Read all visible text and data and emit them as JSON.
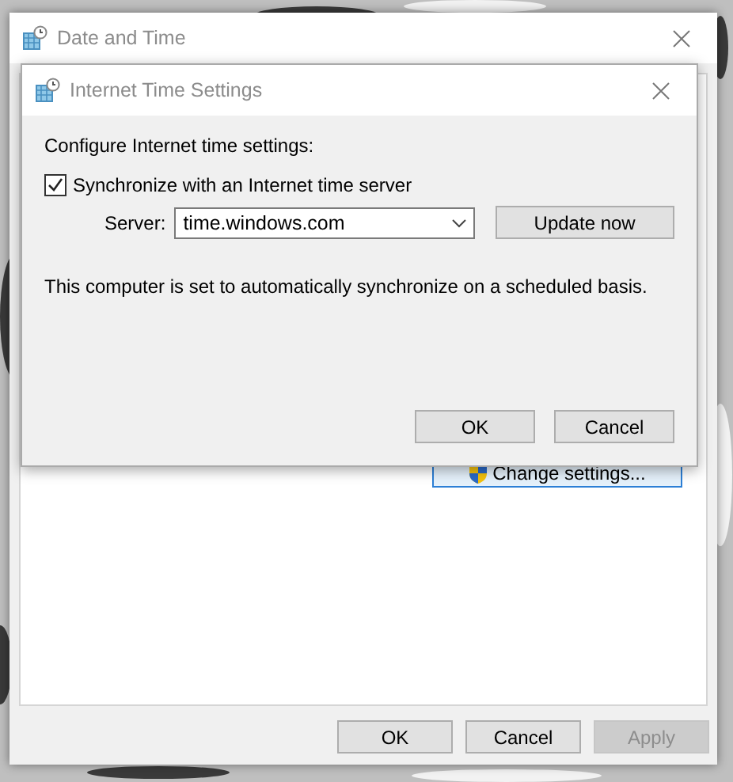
{
  "main_window": {
    "title": "Date and Time",
    "change_settings": "Change settings...",
    "buttons": [
      {
        "label": "OK",
        "disabled": false
      },
      {
        "label": "Cancel",
        "disabled": false
      },
      {
        "label": "Apply",
        "disabled": true
      }
    ]
  },
  "dialog": {
    "title": "Internet Time Settings",
    "heading": "Configure Internet time settings:",
    "sync": {
      "label": "Synchronize with an Internet time server",
      "checked": true
    },
    "server_label": "Server:",
    "server_value": "time.windows.com",
    "update_button": "Update now",
    "status": "This computer is set to automatically synchronize on a scheduled basis.",
    "buttons": [
      "OK",
      "Cancel"
    ]
  }
}
